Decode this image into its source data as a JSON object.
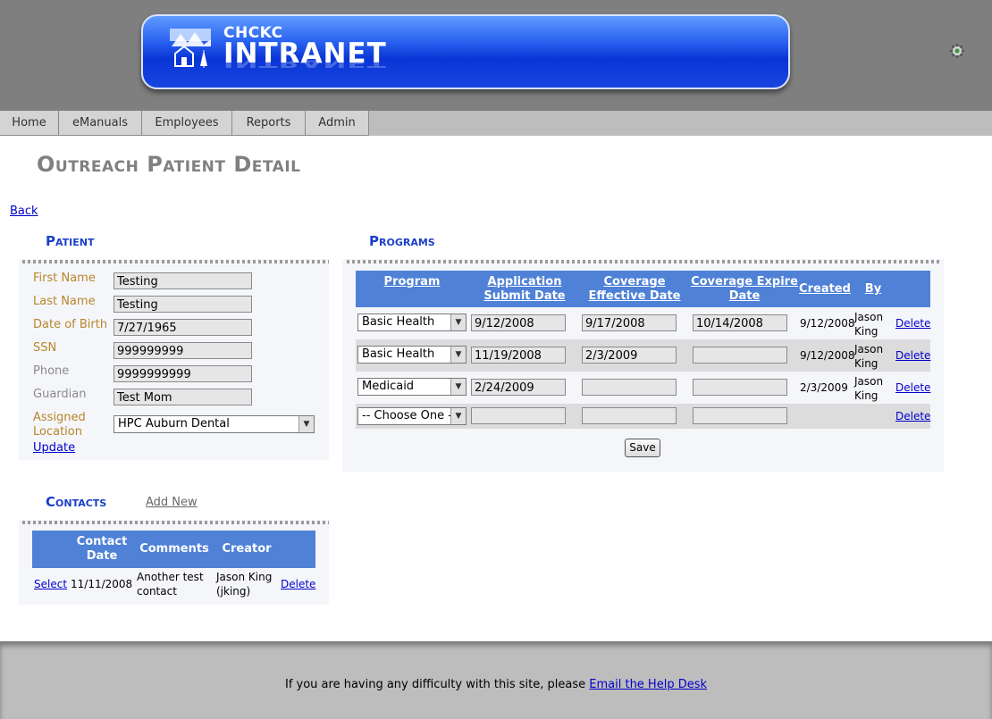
{
  "header": {
    "org": "CHCKC",
    "title": "INTRANET",
    "logo_icon": "mountain-house-logo",
    "settings_icon": "gear-icon"
  },
  "nav": {
    "tabs": [
      {
        "label": "Home"
      },
      {
        "label": "eManuals"
      },
      {
        "label": "Employees"
      },
      {
        "label": "Reports"
      },
      {
        "label": "Admin"
      }
    ]
  },
  "page": {
    "title": "Outreach Patient Detail",
    "back_label": "Back"
  },
  "patient": {
    "heading": "Patient",
    "fields": [
      {
        "label": "First Name",
        "value": "Testing"
      },
      {
        "label": "Last Name",
        "value": "Testing"
      },
      {
        "label": "Date of Birth",
        "value": "7/27/1965"
      },
      {
        "label": "SSN",
        "value": "999999999"
      },
      {
        "label": "Phone",
        "value": "9999999999"
      },
      {
        "label": "Guardian",
        "value": "Test Mom"
      }
    ],
    "location_label_1": "Assigned",
    "location_label_2": "Location",
    "location_value": "HPC Auburn Dental",
    "update_label": "Update"
  },
  "programs": {
    "heading": "Programs",
    "columns": {
      "program": "Program",
      "app_submit_1": "Application",
      "app_submit_2": "Submit Date",
      "cov_eff_1": "Coverage",
      "cov_eff_2": "Effective Date",
      "cov_exp_1": "Coverage Expire",
      "cov_exp_2": "Date",
      "created": "Created",
      "by": "By"
    },
    "rows": [
      {
        "program": "Basic Health",
        "submit": "9/12/2008",
        "effective": "9/17/2008",
        "expire": "10/14/2008",
        "created": "9/12/2008",
        "by_1": "Jason",
        "by_2": "King",
        "delete": "Delete"
      },
      {
        "program": "Basic Health",
        "submit": "11/19/2008",
        "effective": "2/3/2009",
        "expire": "",
        "created": "9/12/2008",
        "by_1": "Jason",
        "by_2": "King",
        "delete": "Delete"
      },
      {
        "program": "Medicaid",
        "submit": "2/24/2009",
        "effective": "",
        "expire": "",
        "created": "2/3/2009",
        "by_1": "Jason",
        "by_2": "King",
        "delete": "Delete"
      },
      {
        "program": "-- Choose One --",
        "submit": "",
        "effective": "",
        "expire": "",
        "created": "",
        "by_1": "",
        "by_2": "",
        "delete": "Delete"
      }
    ],
    "save_label": "Save"
  },
  "contacts": {
    "heading": "Contacts",
    "add_new_label": "Add New",
    "columns": {
      "contact_date_1": "Contact",
      "contact_date_2": "Date",
      "comments": "Comments",
      "creator": "Creator"
    },
    "rows": [
      {
        "select": "Select",
        "date": "11/11/2008",
        "comment_1": "Another test",
        "comment_2": "contact",
        "creator_1": "Jason King",
        "creator_2": "(jking)",
        "delete": "Delete"
      }
    ]
  },
  "footer": {
    "text": "If you are having any difficulty with this site, please ",
    "link": "Email the Help Desk"
  }
}
